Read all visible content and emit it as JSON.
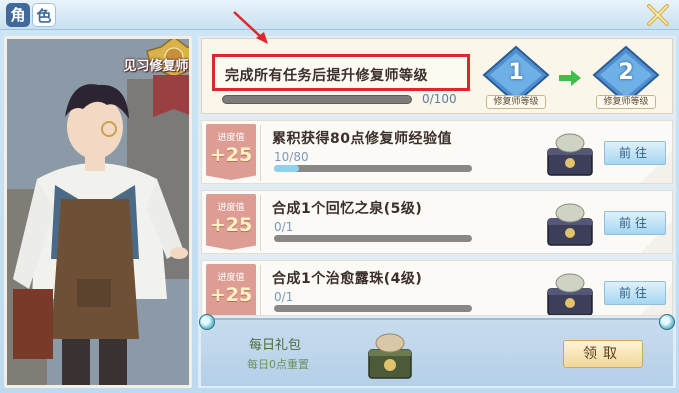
{
  "window": {
    "title_chars": [
      "角",
      "色"
    ]
  },
  "character": {
    "rank_label": "见习修复师"
  },
  "goal": {
    "text": "完成所有任务后提升修复师等级",
    "progress_text": "0/100",
    "progress": 0,
    "from_level": "1",
    "to_level": "2",
    "level_tag": "修复师等级"
  },
  "tasks": [
    {
      "progress_label": "进度值",
      "progress_value": "+25",
      "title": "累积获得80点修复师经验值",
      "count": "10/80",
      "fill": 0.125,
      "button": "前往"
    },
    {
      "progress_label": "进度值",
      "progress_value": "+25",
      "title": "合成1个回忆之泉(5级)",
      "count": "0/1",
      "fill": 0,
      "button": "前往"
    },
    {
      "progress_label": "进度值",
      "progress_value": "+25",
      "title": "合成1个治愈露珠(4级)",
      "count": "0/1",
      "fill": 0,
      "button": "前往"
    }
  ],
  "daily_gift": {
    "title": "每日礼包",
    "subtitle": "每日0点重置",
    "button": "领取"
  },
  "colors": {
    "highlight_box": "#e0262d",
    "progress_fill": "#8fd1ee",
    "tag_bg": "#dd9d94"
  }
}
